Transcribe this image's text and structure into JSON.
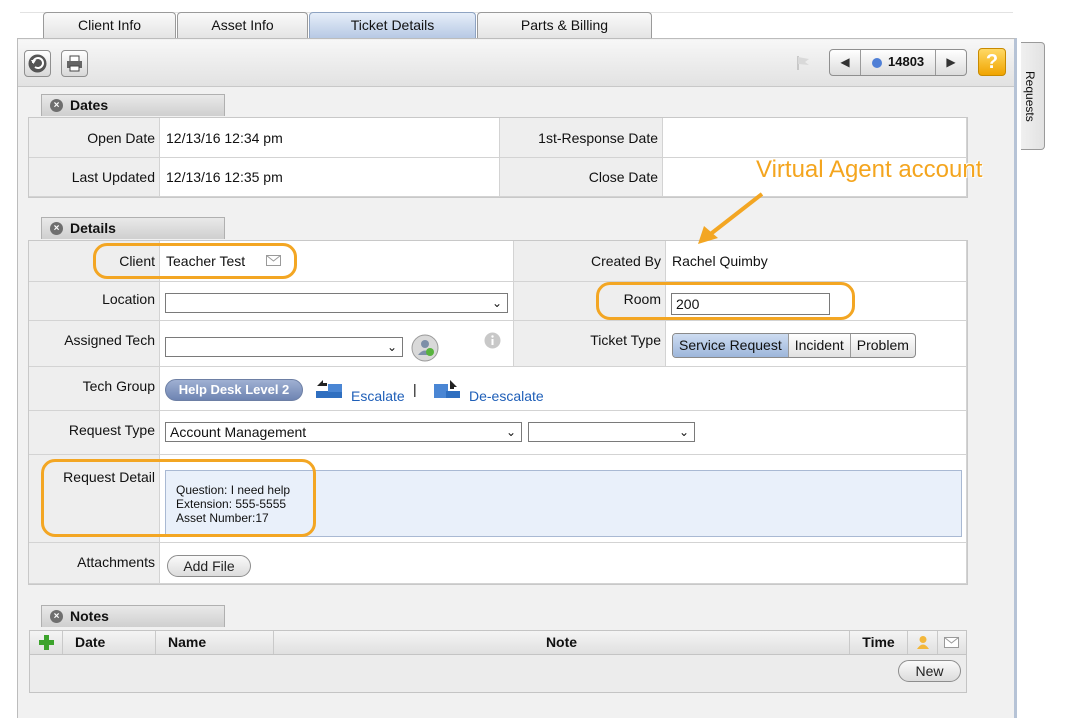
{
  "tabs": [
    {
      "label": "Client Info"
    },
    {
      "label": "Asset Info"
    },
    {
      "label": "Ticket Details",
      "active": true
    },
    {
      "label": "Parts & Billing"
    }
  ],
  "toolbar": {
    "ticket_number": "14803",
    "help_label": "?"
  },
  "side_tab": {
    "label": "Requests"
  },
  "dates": {
    "title": "Dates",
    "open_date_label": "Open Date",
    "open_date_value": "12/13/16 12:34 pm",
    "first_response_label": "1st-Response Date",
    "first_response_value": "",
    "last_updated_label": "Last Updated",
    "last_updated_value": "12/13/16 12:35 pm",
    "close_date_label": "Close Date",
    "close_date_value": ""
  },
  "details": {
    "title": "Details",
    "client_label": "Client",
    "client_value": "Teacher Test",
    "created_by_label": "Created By",
    "created_by_value": "Rachel Quimby",
    "location_label": "Location",
    "location_value": "",
    "room_label": "Room",
    "room_value": "200",
    "assigned_tech_label": "Assigned Tech",
    "assigned_tech_value": "",
    "ticket_type_label": "Ticket Type",
    "ticket_types": [
      "Service Request",
      "Incident",
      "Problem"
    ],
    "ticket_type_selected": "Service Request",
    "tech_group_label": "Tech Group",
    "tech_group_value": "Help Desk  Level 2",
    "escalate_label": "Escalate",
    "separator": "|",
    "deescalate_label": "De-escalate",
    "request_type_label": "Request Type",
    "request_type_value": "Account Management",
    "request_subtype_value": "",
    "request_detail_label": "Request Detail",
    "request_detail_lines": [
      "Question: I need help",
      "Extension: 555-5555",
      "Asset Number:17"
    ],
    "attachments_label": "Attachments",
    "add_file_label": "Add File"
  },
  "annotation": {
    "text": "Virtual Agent account",
    "color": "#f4a51e"
  },
  "notes": {
    "title": "Notes",
    "columns": [
      "Date",
      "Name",
      "Note",
      "Time"
    ],
    "new_label": "New"
  },
  "colors": {
    "accent_highlight": "#f3a623",
    "link": "#1f5fb8"
  }
}
